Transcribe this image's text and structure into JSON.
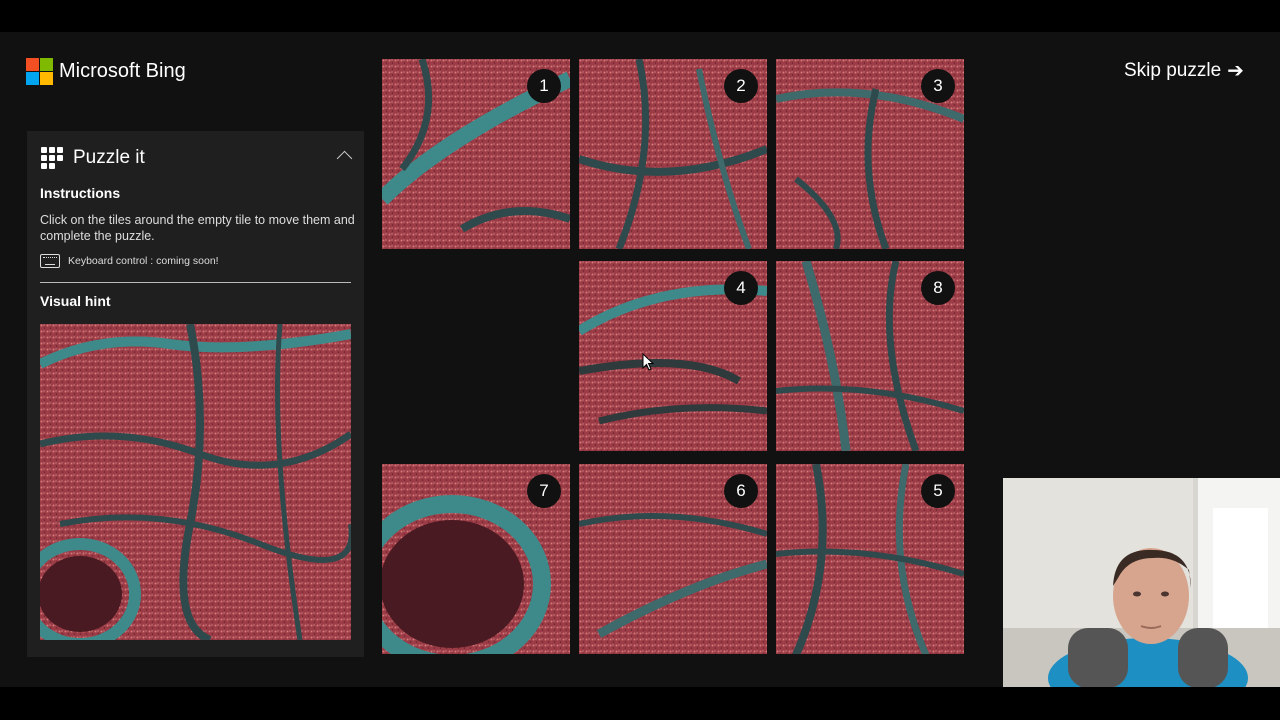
{
  "brand": {
    "name": "Microsoft Bing",
    "logo_icon": "microsoft-logo-icon"
  },
  "panel": {
    "title": "Puzzle it",
    "icon": "grid-icon",
    "collapse_icon": "chevron-up-icon",
    "instructions_title": "Instructions",
    "instructions_text": "Click on the tiles around the empty tile to move them and complete the puzzle.",
    "keyboard_note": "Keyboard control : coming soon!",
    "hint_title": "Visual hint"
  },
  "skip": {
    "label": "Skip puzzle",
    "icon": "arrow-right-icon",
    "arrow": "➔"
  },
  "tiles": [
    "1",
    "2",
    "3",
    "4",
    "8",
    "7",
    "6",
    "5"
  ],
  "colors": {
    "background": "#111111",
    "panel": "#1f1f1f",
    "marsh": "#a8404a",
    "water": "#3e8a8a",
    "badge": "#111111"
  }
}
